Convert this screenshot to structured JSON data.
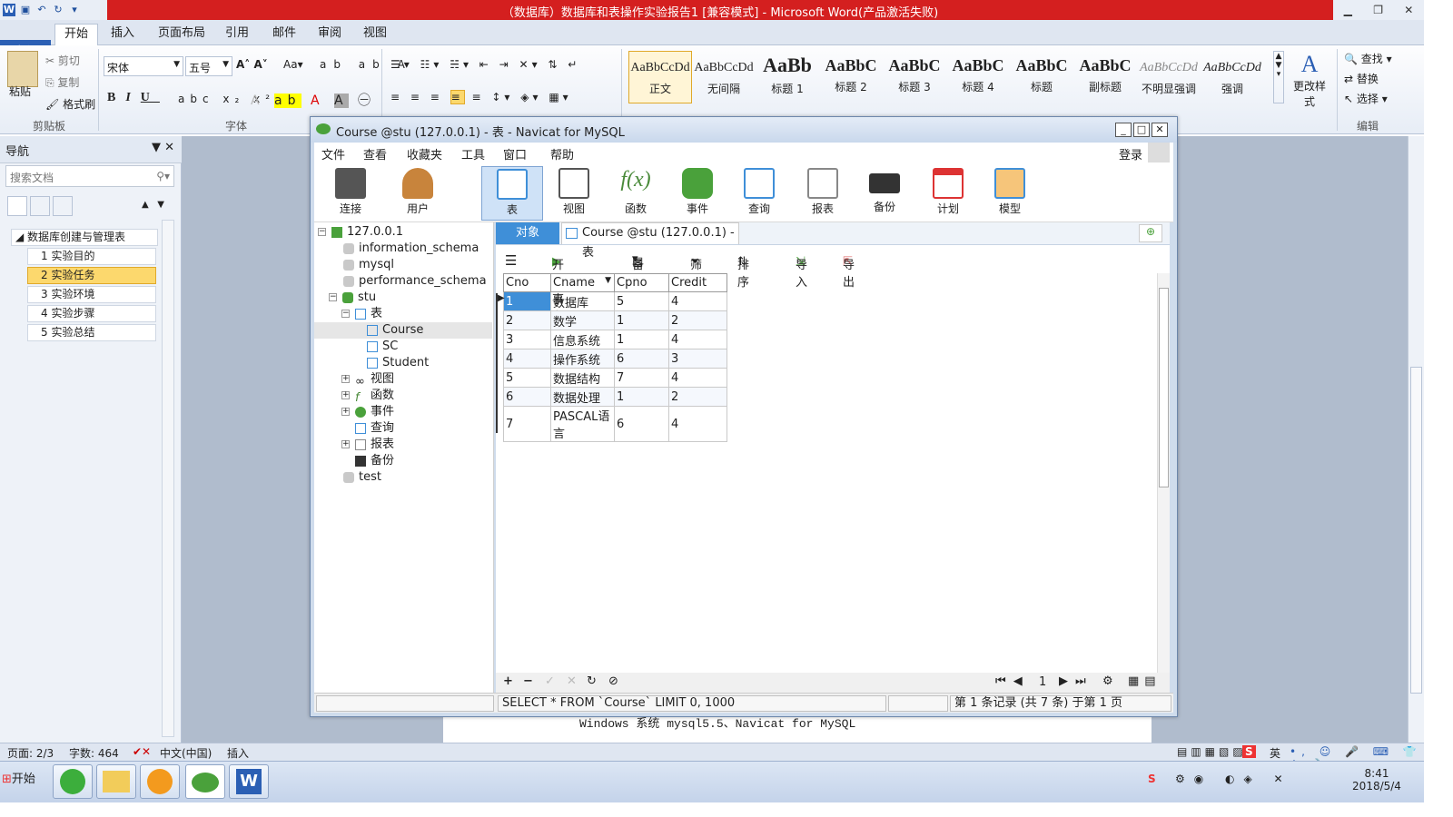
{
  "word": {
    "title": "（数据库）数据库和表操作实验报告1 [兼容模式] - Microsoft Word(产品激活失败)",
    "tabs": [
      "文件",
      "开始",
      "插入",
      "页面布局",
      "引用",
      "邮件",
      "审阅",
      "视图"
    ],
    "clipboard": {
      "paste": "粘贴",
      "cut": "剪切",
      "copy": "复制",
      "format_painter": "格式刷",
      "label": "剪贴板"
    },
    "font": {
      "name": "宋体",
      "size": "五号",
      "label": "字体"
    },
    "styles": [
      {
        "sample": "AaBbCcDd",
        "name": "正文"
      },
      {
        "sample": "AaBbCcDd",
        "name": "无间隔"
      },
      {
        "sample": "AaBb",
        "name": "标题 1"
      },
      {
        "sample": "AaBbC",
        "name": "标题 2"
      },
      {
        "sample": "AaBbC",
        "name": "标题 3"
      },
      {
        "sample": "AaBbC",
        "name": "标题 4"
      },
      {
        "sample": "AaBbC",
        "name": "标题"
      },
      {
        "sample": "AaBbC",
        "name": "副标题"
      },
      {
        "sample": "AaBbCcDd",
        "name": "不明显强调"
      },
      {
        "sample": "AaBbCcDd",
        "name": "强调"
      }
    ],
    "change_styles": "更改样式",
    "edit": {
      "find": "查找",
      "replace": "替换",
      "select": "选择",
      "label": "编辑"
    },
    "nav": {
      "title": "导航",
      "search_placeholder": "搜索文档",
      "root": "数据库创建与管理表",
      "items": [
        "1 实验目的",
        "2 实验任务",
        "3 实验环境",
        "4 实验步骤",
        "5 实验总结"
      ]
    },
    "doc_line": "Windows 系统 mysql5.5、Navicat for MySQL",
    "status": {
      "page": "页面: 2/3",
      "words": "字数: 464",
      "lang": "中文(中国)",
      "mode": "插入"
    }
  },
  "navicat": {
    "title": "Course @stu (127.0.0.1) - 表 - Navicat for MySQL",
    "menu": [
      "文件",
      "查看",
      "收藏夹",
      "工具",
      "窗口",
      "帮助"
    ],
    "login": "登录",
    "tools": [
      "连接",
      "用户",
      "表",
      "视图",
      "函数",
      "事件",
      "查询",
      "报表",
      "备份",
      "计划",
      "模型"
    ],
    "tree": {
      "server": "127.0.0.1",
      "dbs": [
        "information_schema",
        "mysql",
        "performance_schema"
      ],
      "stu": "stu",
      "tables_label": "表",
      "tables": [
        "Course",
        "SC",
        "Student"
      ],
      "nodes": [
        "视图",
        "函数",
        "事件",
        "查询",
        "报表",
        "备份"
      ],
      "test": "test"
    },
    "tab_object": "对象",
    "tab_course": "Course @stu (127.0.0.1) - 表",
    "subtool": [
      "开始事务",
      "备注",
      "筛选",
      "排序",
      "导入",
      "导出"
    ],
    "columns": [
      "Cno",
      "Cname",
      "Cpno",
      "Credit"
    ],
    "rows": [
      [
        "1",
        "数据库",
        "5",
        "4"
      ],
      [
        "2",
        "数学",
        "1",
        "2"
      ],
      [
        "3",
        "信息系统",
        "1",
        "4"
      ],
      [
        "4",
        "操作系统",
        "6",
        "3"
      ],
      [
        "5",
        "数据结构",
        "7",
        "4"
      ],
      [
        "6",
        "数据处理",
        "1",
        "2"
      ],
      [
        "7",
        "PASCAL语言",
        "6",
        "4"
      ]
    ],
    "page_num": "1",
    "sql": "SELECT * FROM `Course` LIMIT 0, 1000",
    "record_info": "第 1 条记录 (共 7 条) 于第 1 页"
  },
  "taskbar": {
    "start": "开始",
    "ime": "英",
    "time": "8:41",
    "date": "2018/5/4"
  },
  "colors": {
    "word_red": "#d41f1f",
    "navicat_blue": "#3f8fd8",
    "nav_selected": "#fcd86d"
  }
}
